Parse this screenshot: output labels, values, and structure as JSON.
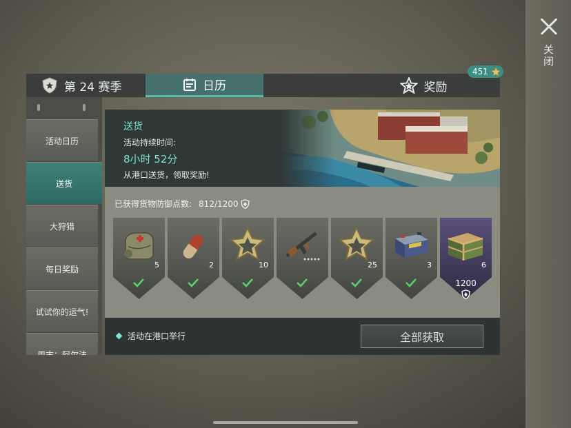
{
  "close": {
    "label": "关闭"
  },
  "tabs": [
    {
      "label": "第 24 赛季",
      "icon": "season-badge-icon"
    },
    {
      "label": "日历",
      "icon": "calendar-icon",
      "active": true
    },
    {
      "label": "奖励",
      "icon": "star-icon"
    }
  ],
  "rewards_badge": {
    "count": "451"
  },
  "sidebar": {
    "items": [
      {
        "label": "活动日历"
      },
      {
        "label": "送货",
        "active": true
      },
      {
        "label": "大狩猎"
      },
      {
        "label": "每日奖励"
      },
      {
        "label": "试试你的运气!"
      },
      {
        "label": "周末：阿尔法"
      }
    ]
  },
  "event": {
    "title": "送货",
    "duration_label": "活动持续时间:",
    "time_left": "8小时 52分",
    "description": "从港口送货，领取奖励!"
  },
  "points": {
    "label": "已获得货物防御点数:",
    "value": "812/1200"
  },
  "rewards": [
    {
      "icon": "first-aid-bag-icon",
      "qty": "5",
      "claimed": true
    },
    {
      "icon": "pill-capsule-icon",
      "qty": "2",
      "claimed": true
    },
    {
      "icon": "gold-star-part-icon",
      "qty": "10",
      "claimed": true
    },
    {
      "icon": "assault-rifle-icon",
      "qty": "",
      "claimed": true
    },
    {
      "icon": "gold-star-part-icon",
      "qty": "25",
      "claimed": true
    },
    {
      "icon": "car-battery-icon",
      "qty": "3",
      "claimed": true
    },
    {
      "icon": "supply-crate-icon",
      "qty": "6",
      "claimed": false,
      "points": "1200"
    }
  ],
  "footer": {
    "note": "活动在港口举行",
    "claim_all": "全部获取"
  },
  "colors": {
    "accent": "#7ee3d5",
    "active_tab": "#45706c",
    "check": "#5fd06a",
    "special_card": "#5a4f7a"
  }
}
